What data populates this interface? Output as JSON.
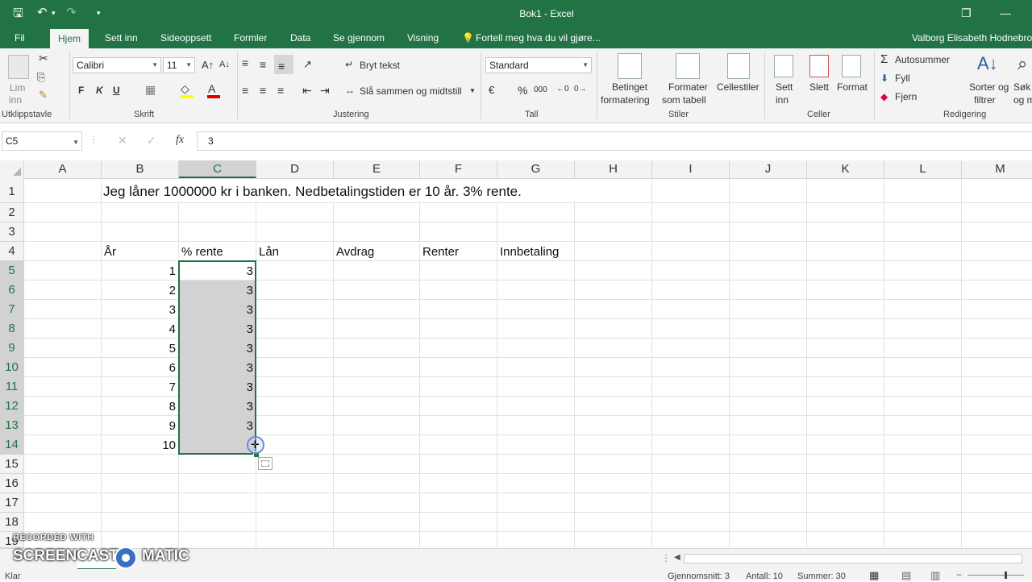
{
  "window": {
    "title": "Bok1 - Excel",
    "user": "Valborg Elisabeth Hodnebrog"
  },
  "quick_access": {
    "save_icon": "save-icon",
    "undo_icon": "undo-icon",
    "redo_icon": "redo-icon",
    "customize_icon": "customize-qat-icon"
  },
  "tabs": [
    "Fil",
    "Hjem",
    "Sett inn",
    "Sideoppsett",
    "Formler",
    "Data",
    "Se gjennom",
    "Visning"
  ],
  "tell_me": "Fortell meg hva du vil gjøre...",
  "ribbon": {
    "clipboard": {
      "paste_label_1": "Lim",
      "paste_label_2": "inn",
      "group": "Utklippstavle"
    },
    "font": {
      "name": "Calibri",
      "size": "11",
      "bold": "F",
      "italic": "K",
      "underline": "U",
      "group": "Skrift"
    },
    "alignment": {
      "wrap": "Bryt tekst",
      "merge": "Slå sammen og midtstill",
      "group": "Justering"
    },
    "number": {
      "format": "Standard",
      "percent": "%",
      "thousands": "000",
      "group": "Tall"
    },
    "styles": {
      "conditional_1": "Betinget",
      "conditional_2": "formatering",
      "table_1": "Formater",
      "table_2": "som tabell",
      "cell_styles": "Cellestiler",
      "group": "Stiler"
    },
    "cells": {
      "insert_1": "Sett",
      "insert_2": "inn",
      "delete": "Slett",
      "format": "Format",
      "group": "Celler"
    },
    "editing": {
      "autosum": "Autosummer",
      "fill": "Fyll",
      "clear": "Fjern",
      "sort_1": "Sorter og",
      "sort_2": "filtrer",
      "find_1": "Søk",
      "find_2": "og m",
      "group": "Redigering"
    }
  },
  "formula_bar": {
    "name_box": "C5",
    "fx": "fx",
    "value": "3"
  },
  "columns": [
    "A",
    "B",
    "C",
    "D",
    "E",
    "F",
    "G",
    "H",
    "I",
    "J",
    "K",
    "L",
    "M"
  ],
  "rows": [
    "1",
    "2",
    "3",
    "4",
    "5",
    "6",
    "7",
    "8",
    "9",
    "10",
    "11",
    "12",
    "13",
    "14",
    "15",
    "16",
    "17",
    "18",
    "19"
  ],
  "sheet": {
    "title_text": "Jeg låner 1000000 kr i banken. Nedbetalingstiden er 10 år. 3% rente.",
    "headers": {
      "B4": "År",
      "C4": "% rente",
      "D4": "Lån",
      "E4": "Avdrag",
      "F4": "Renter",
      "G4": "Innbetaling"
    },
    "years": [
      "1",
      "2",
      "3",
      "4",
      "5",
      "6",
      "7",
      "8",
      "9",
      "10"
    ],
    "rates": [
      "3",
      "3",
      "3",
      "3",
      "3",
      "3",
      "3",
      "3",
      "3",
      ""
    ]
  },
  "watermark": {
    "line1": "RECORDED WITH",
    "line2a": "SCREENCAST",
    "line2b": "MATIC"
  },
  "status": {
    "ready": "Klar",
    "average": "Gjennomsnitt: 3",
    "count": "Antall: 10",
    "sum": "Summer: 30"
  },
  "colors": {
    "excel_green": "#217346",
    "selection": "#d2d2d2"
  }
}
